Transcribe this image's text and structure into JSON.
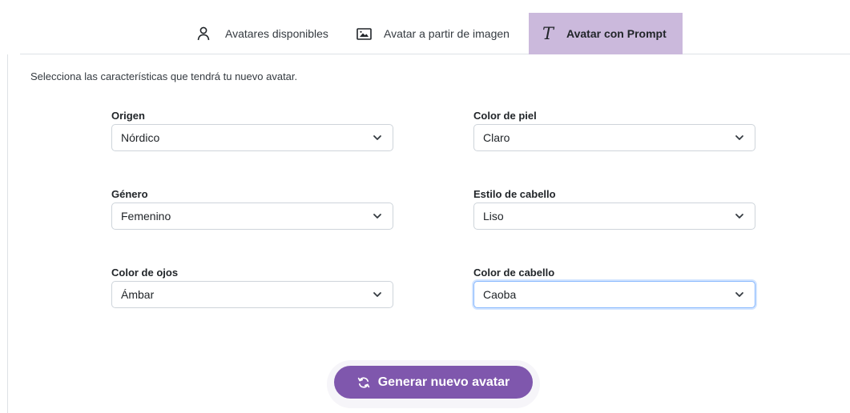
{
  "tabs": [
    {
      "label": "Avatares disponibles",
      "icon": "person-icon"
    },
    {
      "label": "Avatar a partir de imagen",
      "icon": "image-icon"
    },
    {
      "label": "Avatar con Prompt",
      "icon": "text-icon",
      "glyph": "T",
      "active": true
    }
  ],
  "intro_text": "Selecciona las características que tendrá tu nuevo avatar.",
  "fields": {
    "origen": {
      "label": "Origen",
      "value": "Nórdico"
    },
    "color_piel": {
      "label": "Color de piel",
      "value": "Claro"
    },
    "genero": {
      "label": "Género",
      "value": "Femenino"
    },
    "estilo_cabello": {
      "label": "Estilo de cabello",
      "value": "Liso"
    },
    "color_ojos": {
      "label": "Color de ojos",
      "value": "Ámbar"
    },
    "color_cabello": {
      "label": "Color de cabello",
      "value": "Caoba"
    }
  },
  "generate_button": {
    "label": "Generar nuevo avatar",
    "icon": "refresh-icon"
  },
  "colors": {
    "accent": "#7f57ad",
    "active_tab": "#cbb9dc",
    "focus_border": "#86b7fe"
  }
}
